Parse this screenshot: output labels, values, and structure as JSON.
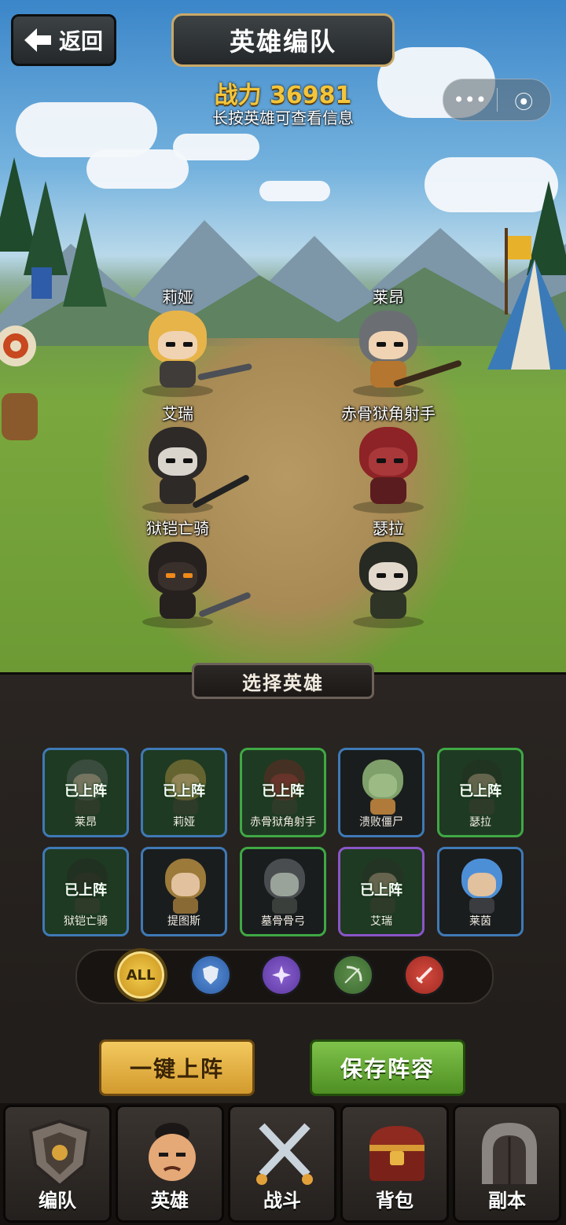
{
  "header": {
    "back_label": "返回",
    "title": "英雄编队"
  },
  "status": {
    "power": "战力 36981",
    "hint": "长按英雄可查看信息"
  },
  "capsule": {
    "more": "•••",
    "close": "⦿"
  },
  "formation": [
    {
      "name": "莉娅"
    },
    {
      "name": "莱昂"
    },
    {
      "name": "艾瑞"
    },
    {
      "name": "赤骨狱角射手"
    },
    {
      "name": "狱铠亡骑"
    },
    {
      "name": "瑟拉"
    }
  ],
  "panel": {
    "title": "选择英雄"
  },
  "hero_cards": [
    {
      "name": "莱昂",
      "status": "已上阵",
      "border": "blue"
    },
    {
      "name": "莉娅",
      "status": "已上阵",
      "border": "blue"
    },
    {
      "name": "赤骨狱角射手",
      "status": "已上阵",
      "border": "green"
    },
    {
      "name": "溃败僵尸",
      "status": "",
      "border": "blue"
    },
    {
      "name": "瑟拉",
      "status": "已上阵",
      "border": "green"
    },
    {
      "name": "狱铠亡骑",
      "status": "已上阵",
      "border": "blue"
    },
    {
      "name": "提图斯",
      "status": "",
      "border": "blue"
    },
    {
      "name": "墓骨骨弓",
      "status": "",
      "border": "green"
    },
    {
      "name": "艾瑞",
      "status": "已上阵",
      "border": "purple"
    },
    {
      "name": "莱茵",
      "status": "",
      "border": "blue"
    }
  ],
  "filters": [
    {
      "label": "ALL",
      "icon": "all-icon",
      "selected": true
    },
    {
      "label": "",
      "icon": "shield-icon",
      "color": "#2b5da6"
    },
    {
      "label": "",
      "icon": "sparkle-icon",
      "color": "#5b36a0"
    },
    {
      "label": "",
      "icon": "bow-icon",
      "color": "#3b6a30"
    },
    {
      "label": "",
      "icon": "sword-icon",
      "color": "#a02a23"
    }
  ],
  "actions": {
    "auto_deploy": "一键上阵",
    "save": "保存阵容"
  },
  "nav": [
    {
      "label": "编队",
      "icon": "formation-shield-icon"
    },
    {
      "label": "英雄",
      "icon": "hero-portrait-icon"
    },
    {
      "label": "战斗",
      "icon": "crossed-swords-icon"
    },
    {
      "label": "背包",
      "icon": "treasure-chest-icon"
    },
    {
      "label": "副本",
      "icon": "dungeon-door-icon"
    }
  ],
  "colors": {
    "accent_gold": "#f4c53a",
    "deploy_green": "#3fa844",
    "save_green": "#5fa42e"
  }
}
